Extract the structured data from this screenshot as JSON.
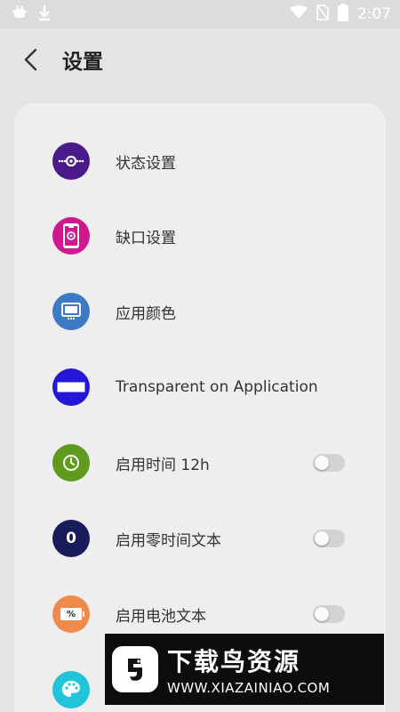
{
  "status_bar": {
    "left_icons": [
      "debug-icon",
      "download-icon"
    ],
    "right_icons": [
      "wifi-icon",
      "no-sim-icon",
      "battery-icon"
    ],
    "time": "2:07"
  },
  "header": {
    "title": "设置"
  },
  "settings": [
    {
      "label": "状态设置",
      "icon": "status-settings-icon",
      "color": "#4b1a8a",
      "has_toggle": false
    },
    {
      "label": "缺口设置",
      "icon": "notch-settings-icon",
      "color": "#d1198f",
      "has_toggle": false
    },
    {
      "label": "应用颜色",
      "icon": "app-color-icon",
      "color": "#3d7ac5",
      "has_toggle": false
    },
    {
      "label": "Transparent on Application",
      "icon": "transparent-icon",
      "color": "#2418d6",
      "has_toggle": false
    },
    {
      "label": "启用时间 12h",
      "icon": "clock-icon",
      "color": "#5f9a1d",
      "has_toggle": true,
      "toggle_on": false
    },
    {
      "label": "启用零时间文本",
      "icon": "zero-time-icon",
      "color": "#181c5a",
      "has_toggle": true,
      "toggle_on": false,
      "icon_text": "0"
    },
    {
      "label": "启用电池文本",
      "icon": "battery-text-icon",
      "color": "#f08a4b",
      "has_toggle": true,
      "toggle_on": false,
      "icon_text": "%"
    },
    {
      "label": "",
      "icon": "palette-icon",
      "color": "#21c4d8",
      "has_toggle": false
    }
  ],
  "watermark": {
    "title": "下载鸟资源",
    "url": "WWW.XIAZAINIAO.COM"
  }
}
